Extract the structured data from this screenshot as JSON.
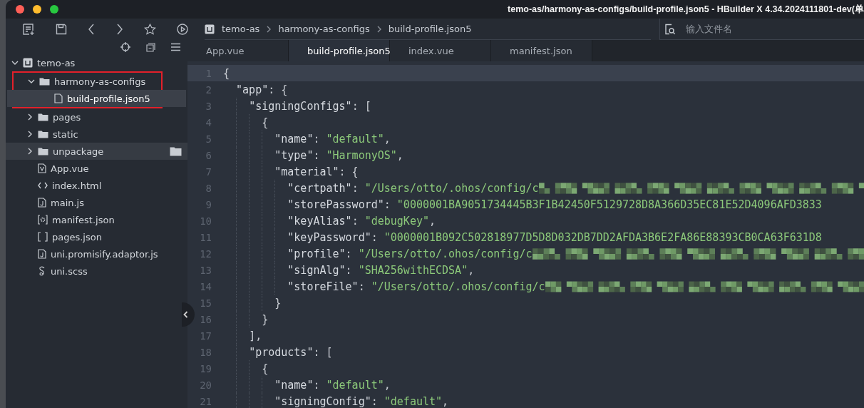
{
  "window": {
    "title": "temo-as/harmony-as-configs/build-profile.json5 - HBuilder X 4.34.2024111801-dev(单"
  },
  "breadcrumb": [
    {
      "kind": "project",
      "label": "temo-as"
    },
    {
      "kind": "folder",
      "label": "harmony-as-configs"
    },
    {
      "kind": "file",
      "label": "build-profile.json5"
    }
  ],
  "search": {
    "placeholder": "输入文件名"
  },
  "tree": [
    {
      "label": "temo-as",
      "kind": "project",
      "expanded": true,
      "selected": false,
      "highlighted": false,
      "outlined": false,
      "children": [
        {
          "label": "harmony-as-configs",
          "kind": "folder",
          "expanded": true,
          "selected": false,
          "highlighted": false,
          "outlined": true,
          "children": [
            {
              "label": "build-profile.json5",
              "kind": "file",
              "selected": true,
              "highlighted": false,
              "outlined": false
            }
          ]
        },
        {
          "label": "pages",
          "kind": "folder",
          "expanded": false,
          "selected": false,
          "highlighted": false,
          "outlined": false
        },
        {
          "label": "static",
          "kind": "folder",
          "expanded": false,
          "selected": false,
          "highlighted": false,
          "outlined": false
        },
        {
          "label": "unpackage",
          "kind": "folder",
          "expanded": false,
          "selected": false,
          "highlighted": true,
          "outlined": false
        },
        {
          "label": "App.vue",
          "kind": "vue",
          "selected": false,
          "highlighted": false,
          "outlined": false
        },
        {
          "label": "index.html",
          "kind": "html",
          "selected": false,
          "highlighted": false,
          "outlined": false
        },
        {
          "label": "main.js",
          "kind": "js",
          "selected": false,
          "highlighted": false,
          "outlined": false
        },
        {
          "label": "manifest.json",
          "kind": "manifest",
          "selected": false,
          "highlighted": false,
          "outlined": false
        },
        {
          "label": "pages.json",
          "kind": "json",
          "selected": false,
          "highlighted": false,
          "outlined": false
        },
        {
          "label": "uni.promisify.adaptor.js",
          "kind": "js",
          "selected": false,
          "highlighted": false,
          "outlined": false
        },
        {
          "label": "uni.scss",
          "kind": "scss",
          "selected": false,
          "highlighted": false,
          "outlined": false
        }
      ]
    }
  ],
  "tabs": [
    {
      "label": "App.vue",
      "selected": false
    },
    {
      "label": "build-profile.json5",
      "selected": true
    },
    {
      "label": "index.vue",
      "selected": false
    },
    {
      "label": "manifest.json",
      "selected": false
    }
  ],
  "editor": {
    "lines": [
      {
        "number": "1",
        "current": true,
        "tokens": [
          {
            "kind": "punct",
            "text": "{"
          }
        ]
      },
      {
        "number": "2",
        "current": false,
        "tokens": [
          {
            "kind": "key",
            "text": "  \"app\""
          },
          {
            "kind": "punct",
            "text": ": {"
          }
        ]
      },
      {
        "number": "3",
        "current": false,
        "tokens": [
          {
            "kind": "key",
            "text": "    \"signingConfigs\""
          },
          {
            "kind": "punct",
            "text": ": ["
          }
        ]
      },
      {
        "number": "4",
        "current": false,
        "tokens": [
          {
            "kind": "punct",
            "text": "      {"
          }
        ]
      },
      {
        "number": "5",
        "current": false,
        "tokens": [
          {
            "kind": "key",
            "text": "        \"name\""
          },
          {
            "kind": "punct",
            "text": ": "
          },
          {
            "kind": "string",
            "text": "\"default\""
          },
          {
            "kind": "punct",
            "text": ","
          }
        ]
      },
      {
        "number": "6",
        "current": false,
        "tokens": [
          {
            "kind": "key",
            "text": "        \"type\""
          },
          {
            "kind": "punct",
            "text": ": "
          },
          {
            "kind": "string",
            "text": "\"HarmonyOS\""
          },
          {
            "kind": "punct",
            "text": ","
          }
        ]
      },
      {
        "number": "7",
        "current": false,
        "tokens": [
          {
            "kind": "key",
            "text": "        \"material\""
          },
          {
            "kind": "punct",
            "text": ": {"
          }
        ]
      },
      {
        "number": "8",
        "current": false,
        "tokens": [
          {
            "kind": "key",
            "text": "          \"certpath\""
          },
          {
            "kind": "punct",
            "text": ": "
          },
          {
            "kind": "string",
            "text": "\"/Users/otto/.ohos/config/c"
          },
          {
            "kind": "redacted"
          }
        ]
      },
      {
        "number": "9",
        "current": false,
        "tokens": [
          {
            "kind": "key",
            "text": "          \"storePassword\""
          },
          {
            "kind": "punct",
            "text": ": "
          },
          {
            "kind": "string",
            "text": "\"0000001BA9051734445B3F1B42450F5129728D8A366D35EC81E52D4096AFD3833"
          }
        ]
      },
      {
        "number": "10",
        "current": false,
        "tokens": [
          {
            "kind": "key",
            "text": "          \"keyAlias\""
          },
          {
            "kind": "punct",
            "text": ": "
          },
          {
            "kind": "string",
            "text": "\"debugKey\""
          },
          {
            "kind": "punct",
            "text": ","
          }
        ]
      },
      {
        "number": "11",
        "current": false,
        "tokens": [
          {
            "kind": "key",
            "text": "          \"keyPassword\""
          },
          {
            "kind": "punct",
            "text": ": "
          },
          {
            "kind": "string",
            "text": "\"0000001B092C502818977D5D8D032DB7DD2AFDA3B6E2FA86E88393CB0CA63F631D8"
          }
        ]
      },
      {
        "number": "12",
        "current": false,
        "tokens": [
          {
            "kind": "key",
            "text": "          \"profile\""
          },
          {
            "kind": "punct",
            "text": ": "
          },
          {
            "kind": "string",
            "text": "\"/Users/otto/.ohos/config/c"
          },
          {
            "kind": "redacted"
          }
        ]
      },
      {
        "number": "13",
        "current": false,
        "tokens": [
          {
            "kind": "key",
            "text": "          \"signAlg\""
          },
          {
            "kind": "punct",
            "text": ": "
          },
          {
            "kind": "string",
            "text": "\"SHA256withECDSA\""
          },
          {
            "kind": "punct",
            "text": ","
          }
        ]
      },
      {
        "number": "14",
        "current": false,
        "tokens": [
          {
            "kind": "key",
            "text": "          \"storeFile\""
          },
          {
            "kind": "punct",
            "text": ": "
          },
          {
            "kind": "string",
            "text": "\"/Users/otto/.ohos/config/c"
          },
          {
            "kind": "redacted"
          }
        ]
      },
      {
        "number": "15",
        "current": false,
        "tokens": [
          {
            "kind": "punct",
            "text": "        }"
          }
        ]
      },
      {
        "number": "16",
        "current": false,
        "tokens": [
          {
            "kind": "punct",
            "text": "      }"
          }
        ]
      },
      {
        "number": "17",
        "current": false,
        "tokens": [
          {
            "kind": "punct",
            "text": "    ],"
          }
        ]
      },
      {
        "number": "18",
        "current": false,
        "tokens": [
          {
            "kind": "key",
            "text": "    \"products\""
          },
          {
            "kind": "punct",
            "text": ": ["
          }
        ]
      },
      {
        "number": "19",
        "current": false,
        "tokens": [
          {
            "kind": "punct",
            "text": "      {"
          }
        ]
      },
      {
        "number": "20",
        "current": false,
        "tokens": [
          {
            "kind": "key",
            "text": "        \"name\""
          },
          {
            "kind": "punct",
            "text": ": "
          },
          {
            "kind": "string",
            "text": "\"default\""
          },
          {
            "kind": "punct",
            "text": ","
          }
        ]
      },
      {
        "number": "21",
        "current": false,
        "tokens": [
          {
            "kind": "key",
            "text": "        \"signingConfig\""
          },
          {
            "kind": "punct",
            "text": ": "
          },
          {
            "kind": "string",
            "text": "\"default\""
          },
          {
            "kind": "punct",
            "text": ","
          }
        ]
      }
    ]
  }
}
